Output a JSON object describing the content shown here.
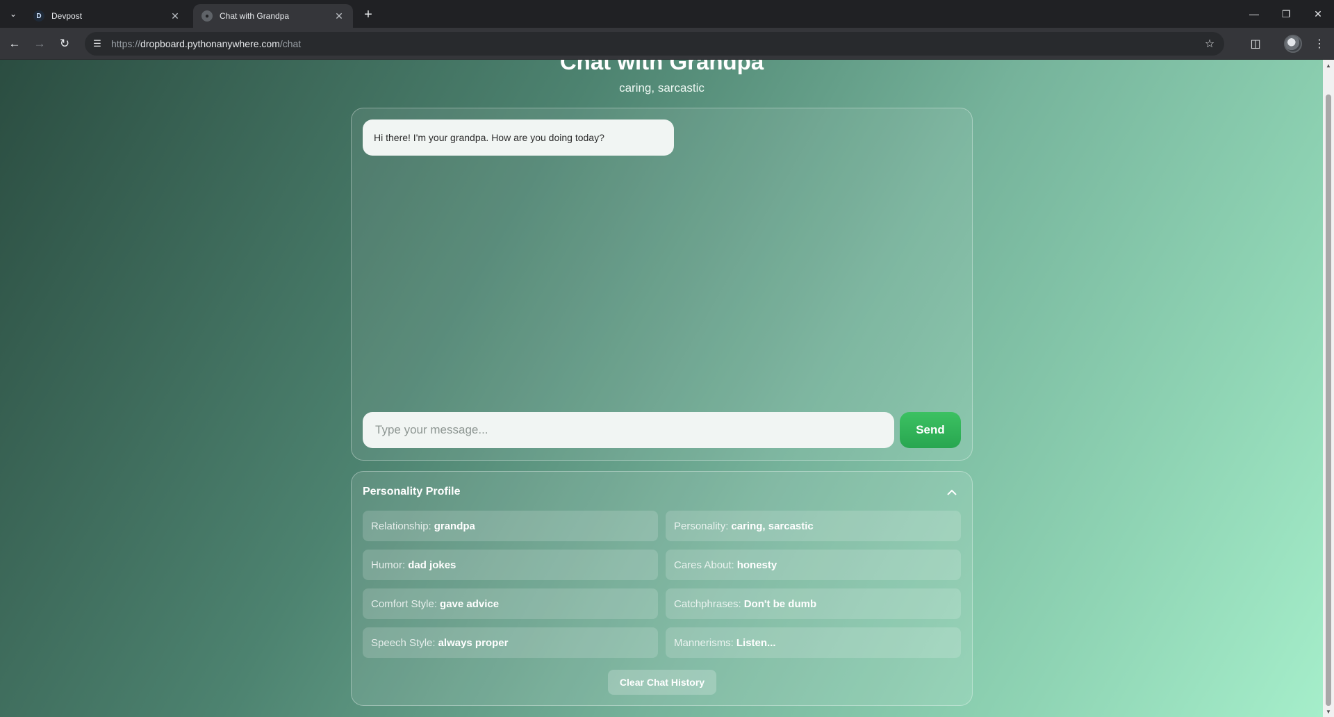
{
  "browser": {
    "tabs": [
      {
        "favicon": "D",
        "title": "Devpost",
        "active": false
      },
      {
        "favicon": "globe",
        "title": "Chat with Grandpa",
        "active": true
      }
    ],
    "url_prefix": "https://",
    "url_host": "dropboard.pythonanywhere.com",
    "url_path": "/chat"
  },
  "page": {
    "title": "Chat with Grandpa",
    "subtitle": "caring, sarcastic"
  },
  "chat": {
    "messages": [
      {
        "sender": "grandpa",
        "text": "Hi there! I'm your grandpa. How are you doing today?"
      }
    ],
    "input_placeholder": "Type your message...",
    "input_value": "",
    "send_label": "Send"
  },
  "profile": {
    "title": "Personality Profile",
    "traits": [
      {
        "key": "Relationship:",
        "value": "grandpa"
      },
      {
        "key": "Personality:",
        "value": "caring, sarcastic"
      },
      {
        "key": "Humor:",
        "value": "dad jokes"
      },
      {
        "key": "Cares About:",
        "value": "honesty"
      },
      {
        "key": "Comfort Style:",
        "value": "gave advice"
      },
      {
        "key": "Catchphrases:",
        "value": "Don't be dumb"
      },
      {
        "key": "Speech Style:",
        "value": "always proper"
      },
      {
        "key": "Mannerisms:",
        "value": "Listen..."
      }
    ],
    "clear_label": "Clear Chat History"
  },
  "colors": {
    "accent_green": "#2fb457",
    "bubble_bg": "#f1f5f3"
  }
}
